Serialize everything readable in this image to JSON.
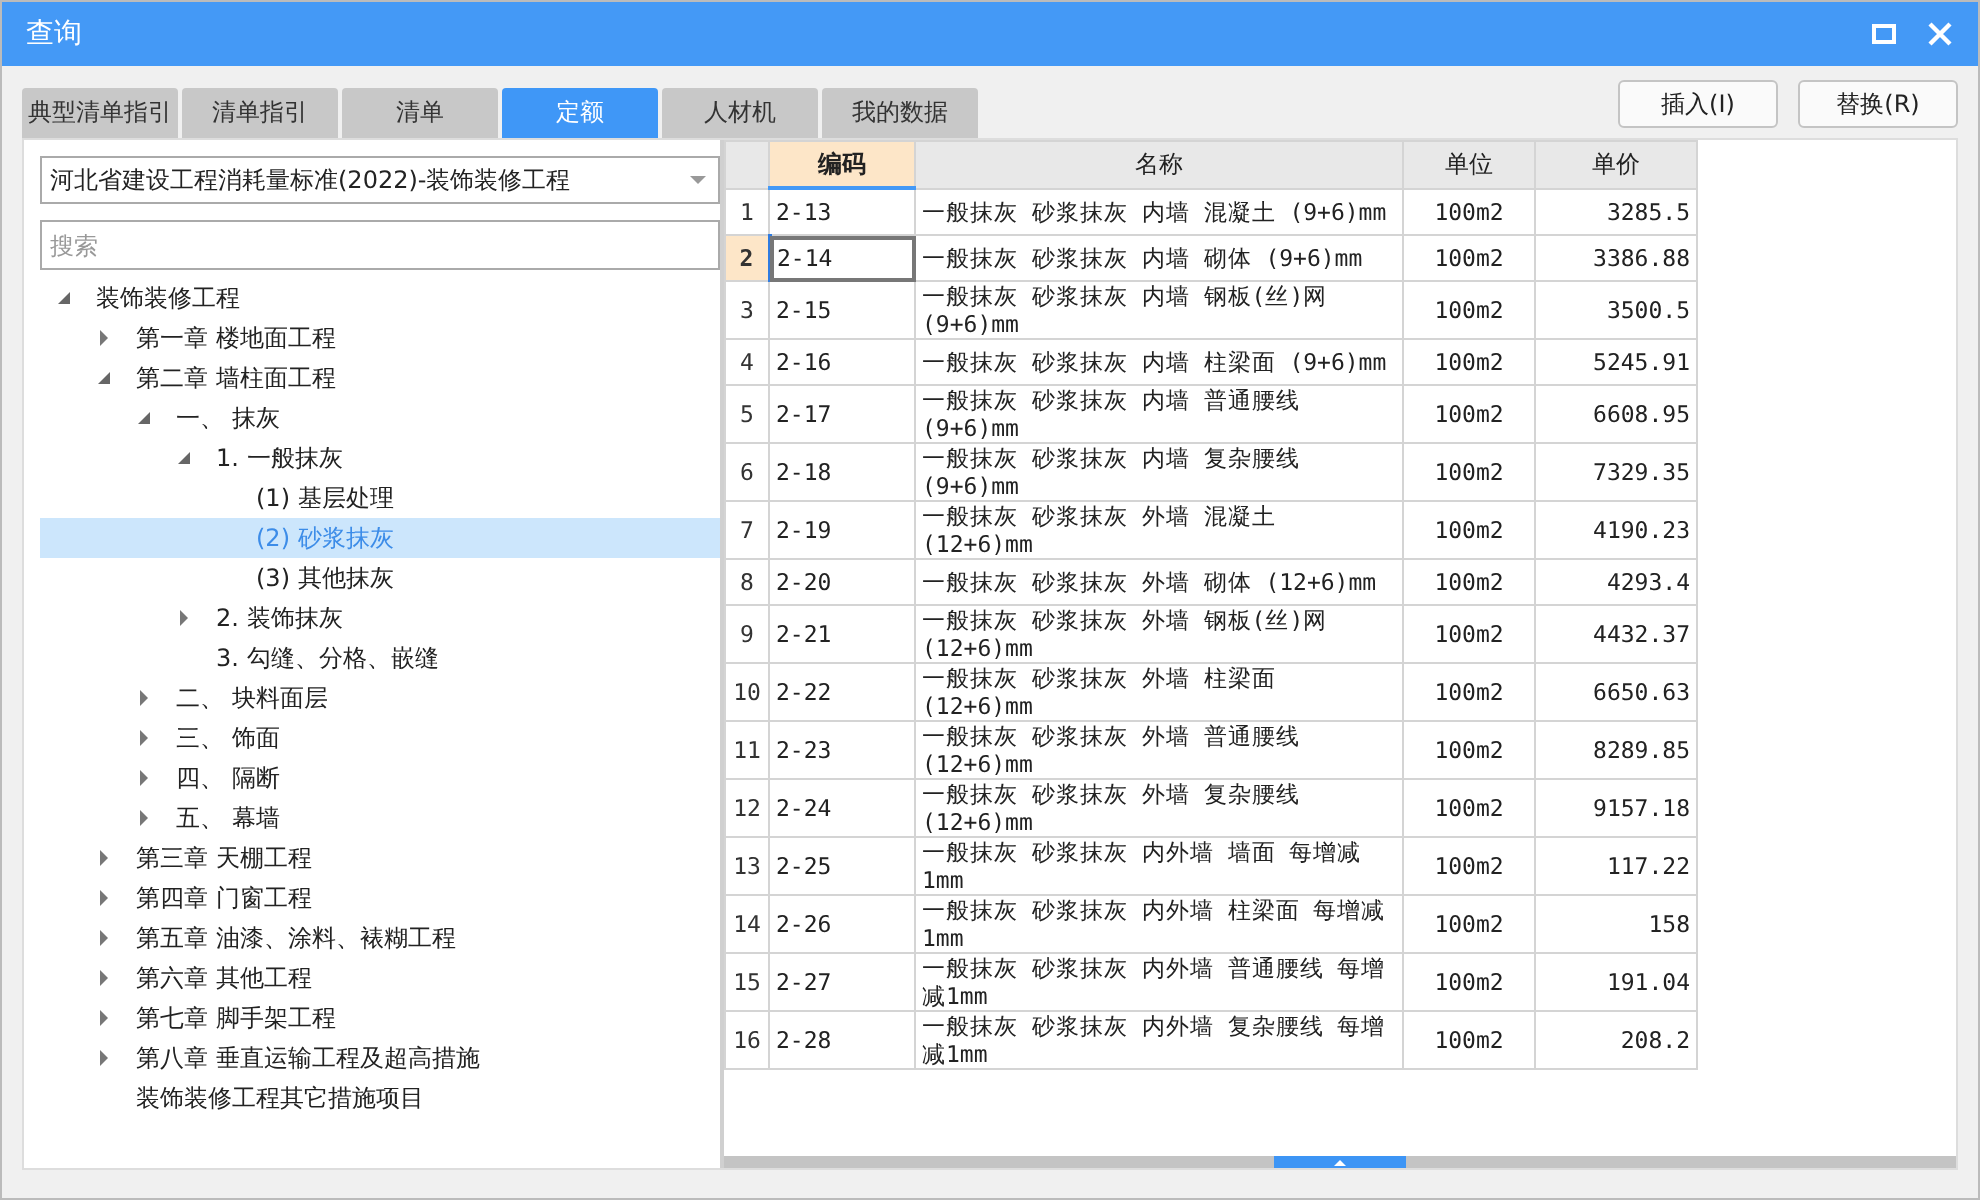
{
  "window": {
    "title": "查询"
  },
  "tabs": [
    {
      "label": "典型清单指引",
      "selected": false
    },
    {
      "label": "清单指引",
      "selected": false
    },
    {
      "label": "清单",
      "selected": false
    },
    {
      "label": "定额",
      "selected": true
    },
    {
      "label": "人材机",
      "selected": false
    },
    {
      "label": "我的数据",
      "selected": false
    }
  ],
  "buttons": [
    "插入(I)",
    "替换(R)"
  ],
  "library_select": {
    "value": "河北省建设工程消耗量标准(2022)-装饰装修工程"
  },
  "search": {
    "placeholder": "搜索"
  },
  "tree": [
    {
      "label": "装饰装修工程",
      "expanded": true,
      "selected": false,
      "children": [
        {
          "label": "第一章 楼地面工程",
          "expanded": false,
          "selected": false
        },
        {
          "label": "第二章 墙柱面工程",
          "expanded": true,
          "selected": false,
          "children": [
            {
              "label": "一、 抹灰",
              "expanded": true,
              "selected": false,
              "children": [
                {
                  "label": "1. 一般抹灰",
                  "expanded": true,
                  "selected": false,
                  "children": [
                    {
                      "label": "(1) 基层处理",
                      "selected": false
                    },
                    {
                      "label": "(2) 砂浆抹灰",
                      "selected": true
                    },
                    {
                      "label": "(3) 其他抹灰",
                      "selected": false
                    }
                  ]
                },
                {
                  "label": "2. 装饰抹灰",
                  "expanded": false,
                  "selected": false
                },
                {
                  "label": "3. 勾缝、分格、嵌缝",
                  "selected": false
                }
              ]
            },
            {
              "label": "二、 块料面层",
              "expanded": false,
              "selected": false
            },
            {
              "label": "三、 饰面",
              "expanded": false,
              "selected": false
            },
            {
              "label": "四、 隔断",
              "expanded": false,
              "selected": false
            },
            {
              "label": "五、 幕墙",
              "expanded": false,
              "selected": false
            }
          ]
        },
        {
          "label": "第三章 天棚工程",
          "expanded": false,
          "selected": false
        },
        {
          "label": "第四章 门窗工程",
          "expanded": false,
          "selected": false
        },
        {
          "label": "第五章 油漆、涂料、裱糊工程",
          "expanded": false,
          "selected": false
        },
        {
          "label": "第六章 其他工程",
          "expanded": false,
          "selected": false
        },
        {
          "label": "第七章 脚手架工程",
          "expanded": false,
          "selected": false
        },
        {
          "label": "第八章 垂直运输工程及超高措施",
          "expanded": false,
          "selected": false
        },
        {
          "label": "装饰装修工程其它措施项目",
          "selected": false
        }
      ]
    }
  ],
  "table": {
    "columns": [
      "编码",
      "名称",
      "单位",
      "单价"
    ],
    "rows": [
      {
        "num": "1",
        "code": "2-13",
        "name": "一般抹灰 砂浆抹灰 内墙 混凝土 (9+6)mm",
        "unit": "100m2",
        "price": "3285.5",
        "selected": false
      },
      {
        "num": "2",
        "code": "2-14",
        "name": "一般抹灰 砂浆抹灰 内墙 砌体 (9+6)mm",
        "unit": "100m2",
        "price": "3386.88",
        "selected": true
      },
      {
        "num": "3",
        "code": "2-15",
        "name": "一般抹灰 砂浆抹灰 内墙 钢板(丝)网 (9+6)mm",
        "unit": "100m2",
        "price": "3500.5",
        "selected": false
      },
      {
        "num": "4",
        "code": "2-16",
        "name": "一般抹灰 砂浆抹灰 内墙 柱梁面 (9+6)mm",
        "unit": "100m2",
        "price": "5245.91",
        "selected": false
      },
      {
        "num": "5",
        "code": "2-17",
        "name": "一般抹灰 砂浆抹灰 内墙 普通腰线 (9+6)mm",
        "unit": "100m2",
        "price": "6608.95",
        "selected": false
      },
      {
        "num": "6",
        "code": "2-18",
        "name": "一般抹灰 砂浆抹灰 内墙 复杂腰线 (9+6)mm",
        "unit": "100m2",
        "price": "7329.35",
        "selected": false
      },
      {
        "num": "7",
        "code": "2-19",
        "name": "一般抹灰 砂浆抹灰 外墙 混凝土 (12+6)mm",
        "unit": "100m2",
        "price": "4190.23",
        "selected": false
      },
      {
        "num": "8",
        "code": "2-20",
        "name": "一般抹灰 砂浆抹灰 外墙 砌体 (12+6)mm",
        "unit": "100m2",
        "price": "4293.4",
        "selected": false
      },
      {
        "num": "9",
        "code": "2-21",
        "name": "一般抹灰 砂浆抹灰 外墙 钢板(丝)网 (12+6)mm",
        "unit": "100m2",
        "price": "4432.37",
        "selected": false
      },
      {
        "num": "10",
        "code": "2-22",
        "name": "一般抹灰 砂浆抹灰 外墙 柱梁面 (12+6)mm",
        "unit": "100m2",
        "price": "6650.63",
        "selected": false
      },
      {
        "num": "11",
        "code": "2-23",
        "name": "一般抹灰 砂浆抹灰 外墙 普通腰线 (12+6)mm",
        "unit": "100m2",
        "price": "8289.85",
        "selected": false
      },
      {
        "num": "12",
        "code": "2-24",
        "name": "一般抹灰 砂浆抹灰 外墙 复杂腰线 (12+6)mm",
        "unit": "100m2",
        "price": "9157.18",
        "selected": false
      },
      {
        "num": "13",
        "code": "2-25",
        "name": "一般抹灰 砂浆抹灰 内外墙 墙面 每增减1mm",
        "unit": "100m2",
        "price": "117.22",
        "selected": false
      },
      {
        "num": "14",
        "code": "2-26",
        "name": "一般抹灰 砂浆抹灰 内外墙 柱梁面 每增减1mm",
        "unit": "100m2",
        "price": "158",
        "selected": false
      },
      {
        "num": "15",
        "code": "2-27",
        "name": "一般抹灰 砂浆抹灰 内外墙 普通腰线 每增减1mm",
        "unit": "100m2",
        "price": "191.04",
        "selected": false
      },
      {
        "num": "16",
        "code": "2-28",
        "name": "一般抹灰 砂浆抹灰 内外墙 复杂腰线 每增减1mm",
        "unit": "100m2",
        "price": "208.2",
        "selected": false
      }
    ]
  }
}
